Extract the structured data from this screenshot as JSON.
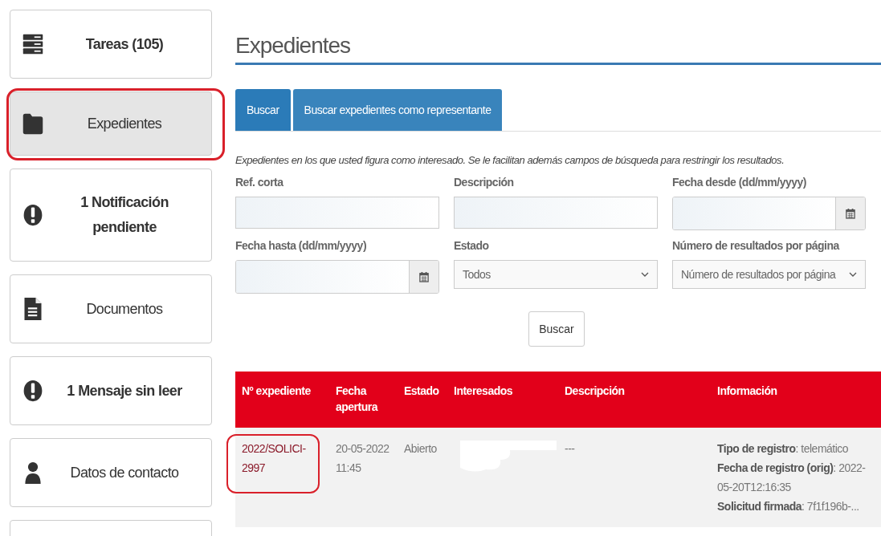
{
  "sidebar": {
    "items": [
      {
        "label": "Tareas (105)",
        "kind": "server",
        "bold": true,
        "selected": false,
        "annotated": false
      },
      {
        "label": "Expedientes",
        "kind": "folder",
        "bold": false,
        "selected": true,
        "annotated": true
      },
      {
        "label": "1 Notificación pendiente",
        "kind": "alert",
        "bold": true,
        "selected": false,
        "annotated": false
      },
      {
        "label": "Documentos",
        "kind": "document",
        "bold": false,
        "selected": false,
        "annotated": false
      },
      {
        "label": "1 Mensaje sin leer",
        "kind": "alert",
        "bold": true,
        "selected": false,
        "annotated": false
      },
      {
        "label": "Datos de contacto",
        "kind": "user",
        "bold": false,
        "selected": false,
        "annotated": false
      }
    ]
  },
  "page": {
    "title": "Expedientes"
  },
  "tabs": [
    {
      "label": "Buscar",
      "selected": true
    },
    {
      "label": "Buscar expedientes como representante",
      "selected": false
    }
  ],
  "intro": "Expedientes en los que usted figura como interesado. Se le facilitan además campos de búsqueda para restringir los resultados.",
  "fields": [
    {
      "label": "Ref. corta",
      "kind": "text"
    },
    {
      "label": "Descripción",
      "kind": "text"
    },
    {
      "label": "Fecha desde (dd/mm/yyyy)",
      "kind": "date"
    },
    {
      "label": "Fecha hasta (dd/mm/yyyy)",
      "kind": "date"
    },
    {
      "label": "Estado",
      "kind": "select",
      "value": "Todos"
    },
    {
      "label": "Número de resultados por página",
      "kind": "select",
      "value": "Número de resultados por página"
    }
  ],
  "search_button": "Buscar",
  "table": {
    "columns": [
      "Nº expediente",
      "Fecha apertura",
      "Estado",
      "Interesados",
      "Descripción",
      "Información"
    ],
    "rows": [
      {
        "expediente": "2022/SOLICI-2997",
        "annotated": true,
        "fecha": "20-05-2022 11:45",
        "estado": "Abierto",
        "interesados_redacted": true,
        "descripcion": "---",
        "informacion": [
          "**Tipo de registro**: telemático",
          "**Fecha de registro (orig)**: 2022-05-20T12:16:35",
          "**Solicitud firmada**: 7f1f196b-..."
        ]
      }
    ]
  }
}
